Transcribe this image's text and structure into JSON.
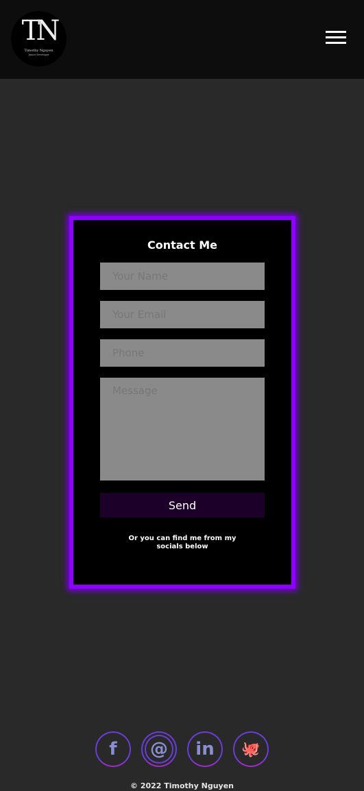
{
  "header": {
    "logo": {
      "initials": "TN",
      "name": "Timothy Nguyen",
      "subtitle": "Junior Developer"
    },
    "menu_icon": "hamburger-icon"
  },
  "contact": {
    "title": "Contact Me",
    "name_placeholder": "Your Name",
    "email_placeholder": "Your Email",
    "phone_placeholder": "Phone",
    "message_placeholder": "Message",
    "send_label": "Send",
    "note": "Or you can find me from my socials below"
  },
  "socials": [
    {
      "icon": "facebook-icon",
      "glyph": "f"
    },
    {
      "icon": "email-icon",
      "glyph": "@"
    },
    {
      "icon": "linkedin-icon",
      "glyph": "in"
    },
    {
      "icon": "github-icon",
      "glyph": "🐙"
    }
  ],
  "footer": {
    "copyright": "© 2022 Timothy Nguyen"
  },
  "colors": {
    "accent": "#8d00ff",
    "button": "#1d0029"
  }
}
